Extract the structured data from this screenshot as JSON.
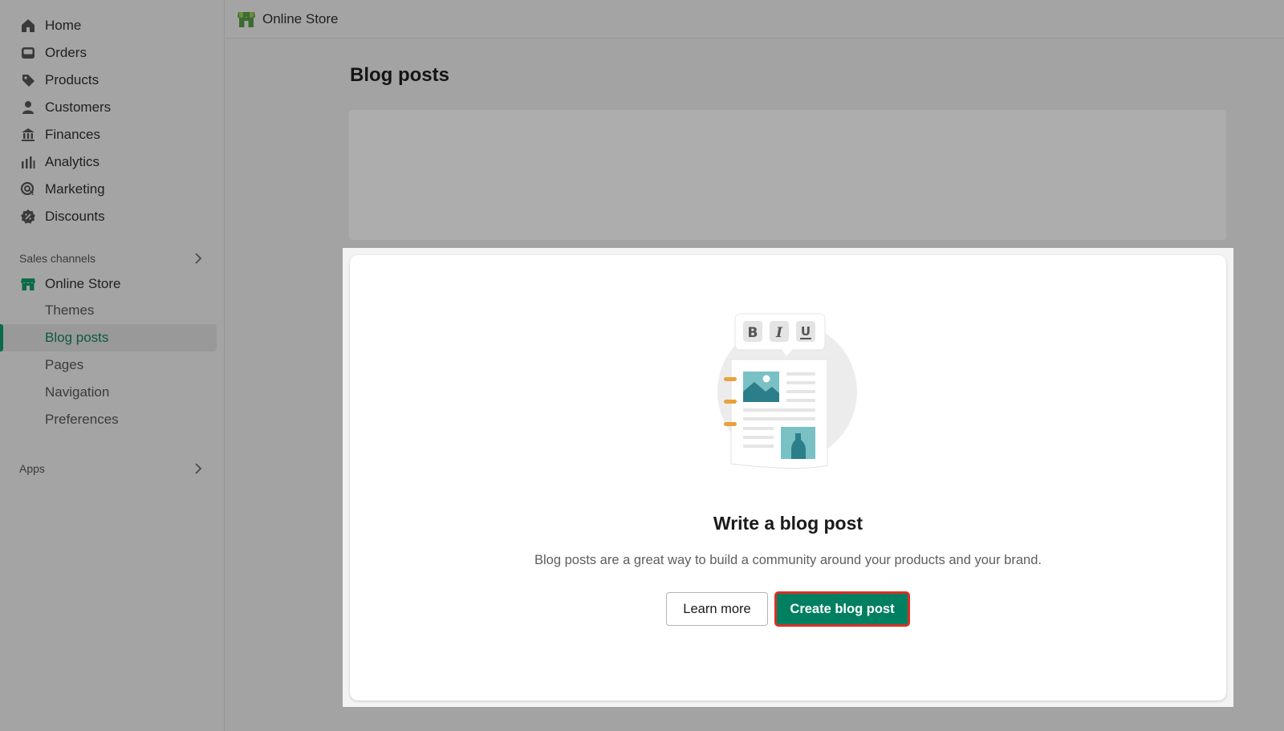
{
  "sidebar": {
    "items": [
      {
        "label": "Home",
        "icon": "home-icon"
      },
      {
        "label": "Orders",
        "icon": "inbox-icon"
      },
      {
        "label": "Products",
        "icon": "tag-icon"
      },
      {
        "label": "Customers",
        "icon": "person-icon"
      },
      {
        "label": "Finances",
        "icon": "bank-icon"
      },
      {
        "label": "Analytics",
        "icon": "bar-chart-icon"
      },
      {
        "label": "Marketing",
        "icon": "target-icon"
      },
      {
        "label": "Discounts",
        "icon": "discount-icon"
      }
    ],
    "sales_channels_label": "Sales channels",
    "online_store": {
      "label": "Online Store",
      "icon": "store-icon"
    },
    "sub_items": [
      {
        "label": "Themes"
      },
      {
        "label": "Blog posts",
        "active": true
      },
      {
        "label": "Pages"
      },
      {
        "label": "Navigation"
      },
      {
        "label": "Preferences"
      }
    ],
    "apps_label": "Apps"
  },
  "topbar": {
    "title": "Online Store",
    "icon": "store-icon"
  },
  "page": {
    "title": "Blog posts"
  },
  "empty_state": {
    "title": "Write a blog post",
    "description": "Blog posts are a great way to build a community around your products and your brand.",
    "learn_more_label": "Learn more",
    "create_label": "Create blog post",
    "illustration": "blog-post-illustration",
    "toolbar_letters": [
      "B",
      "I",
      "U"
    ]
  },
  "colors": {
    "primary": "#008060",
    "active_text": "#0b5a3d",
    "highlight_border": "#d93025"
  }
}
